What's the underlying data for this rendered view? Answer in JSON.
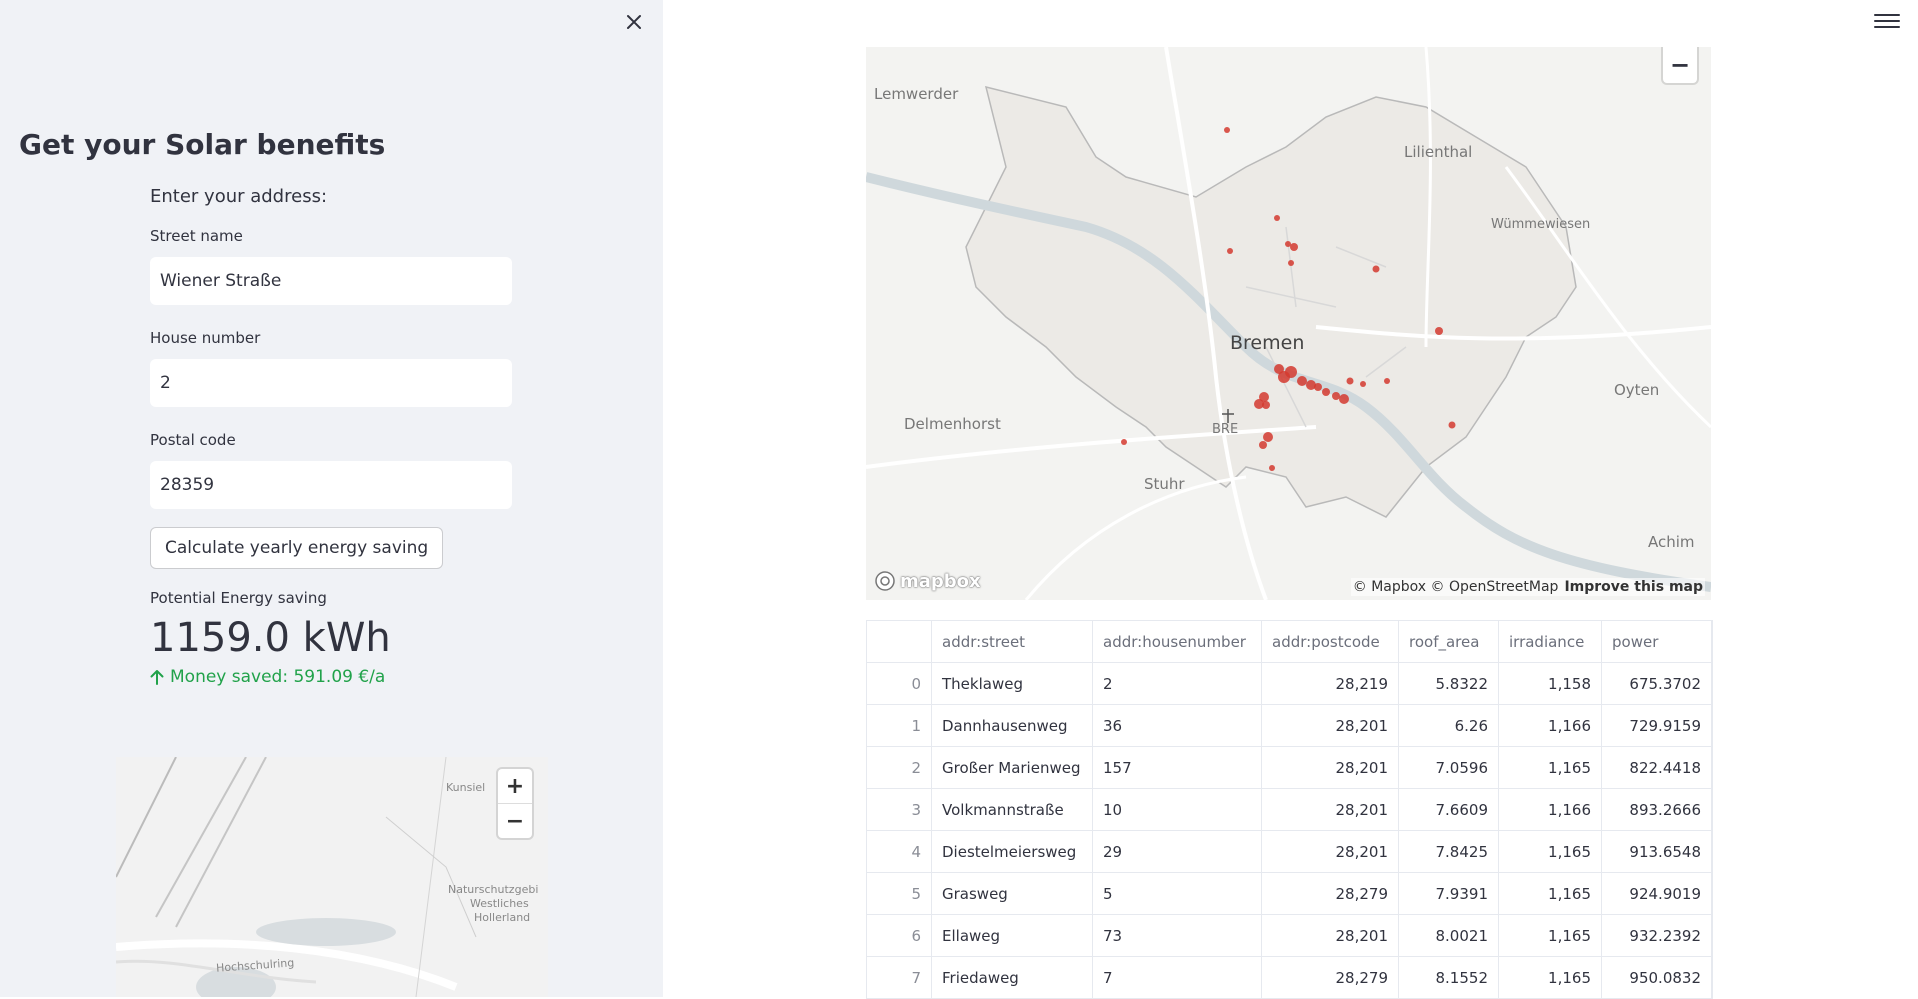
{
  "sidebar": {
    "title": "Get your Solar benefits",
    "prompt": "Enter your address:",
    "street_label": "Street name",
    "street_value": "Wiener Straße",
    "house_label": "House number",
    "house_value": "2",
    "postal_label": "Postal code",
    "postal_value": "28359",
    "calc_button": "Calculate yearly energy saving",
    "metric_label": "Potential Energy saving",
    "metric_value": "1159.0 kWh",
    "metric_delta": "Money saved: 591.09 €/a",
    "mini_map": {
      "zoom_in": "+",
      "zoom_out": "−",
      "labels": [
        "Kunsiel",
        "Naturschutzgebi",
        "Westliches",
        "Hollerland",
        "Hochschulring"
      ]
    }
  },
  "map": {
    "zoom_out": "−",
    "labels": [
      "Lemwerder",
      "Lilienthal",
      "Wümmewiesen",
      "Bremen",
      "Oyten",
      "Delmenhorst",
      "BRE",
      "Stuhr",
      "Achim"
    ],
    "attribution": "© Mapbox © OpenStreetMap",
    "improve": "Improve this map",
    "logo": "mapbox"
  },
  "table": {
    "columns": [
      "",
      "addr:street",
      "addr:housenumber",
      "addr:postcode",
      "roof_area",
      "irradiance",
      "power"
    ],
    "rows": [
      [
        "0",
        "Theklaweg",
        "2",
        "28,219",
        "5.8322",
        "1,158",
        "675.3702"
      ],
      [
        "1",
        "Dannhausenweg",
        "36",
        "28,201",
        "6.26",
        "1,166",
        "729.9159"
      ],
      [
        "2",
        "Großer Marienweg",
        "157",
        "28,201",
        "7.0596",
        "1,165",
        "822.4418"
      ],
      [
        "3",
        "Volkmannstraße",
        "10",
        "28,201",
        "7.6609",
        "1,166",
        "893.2666"
      ],
      [
        "4",
        "Diestelmeiersweg",
        "29",
        "28,201",
        "7.8425",
        "1,165",
        "913.6548"
      ],
      [
        "5",
        "Grasweg",
        "5",
        "28,279",
        "7.9391",
        "1,165",
        "924.9019"
      ],
      [
        "6",
        "Ellaweg",
        "73",
        "28,201",
        "8.0021",
        "1,165",
        "932.2392"
      ],
      [
        "7",
        "Friedaweg",
        "7",
        "28,279",
        "8.1552",
        "1,165",
        "950.0832"
      ]
    ]
  },
  "colors": {
    "sidebar_bg": "#f0f2f6",
    "delta_green": "#21a24a",
    "marker_red": "#d43a2f"
  }
}
